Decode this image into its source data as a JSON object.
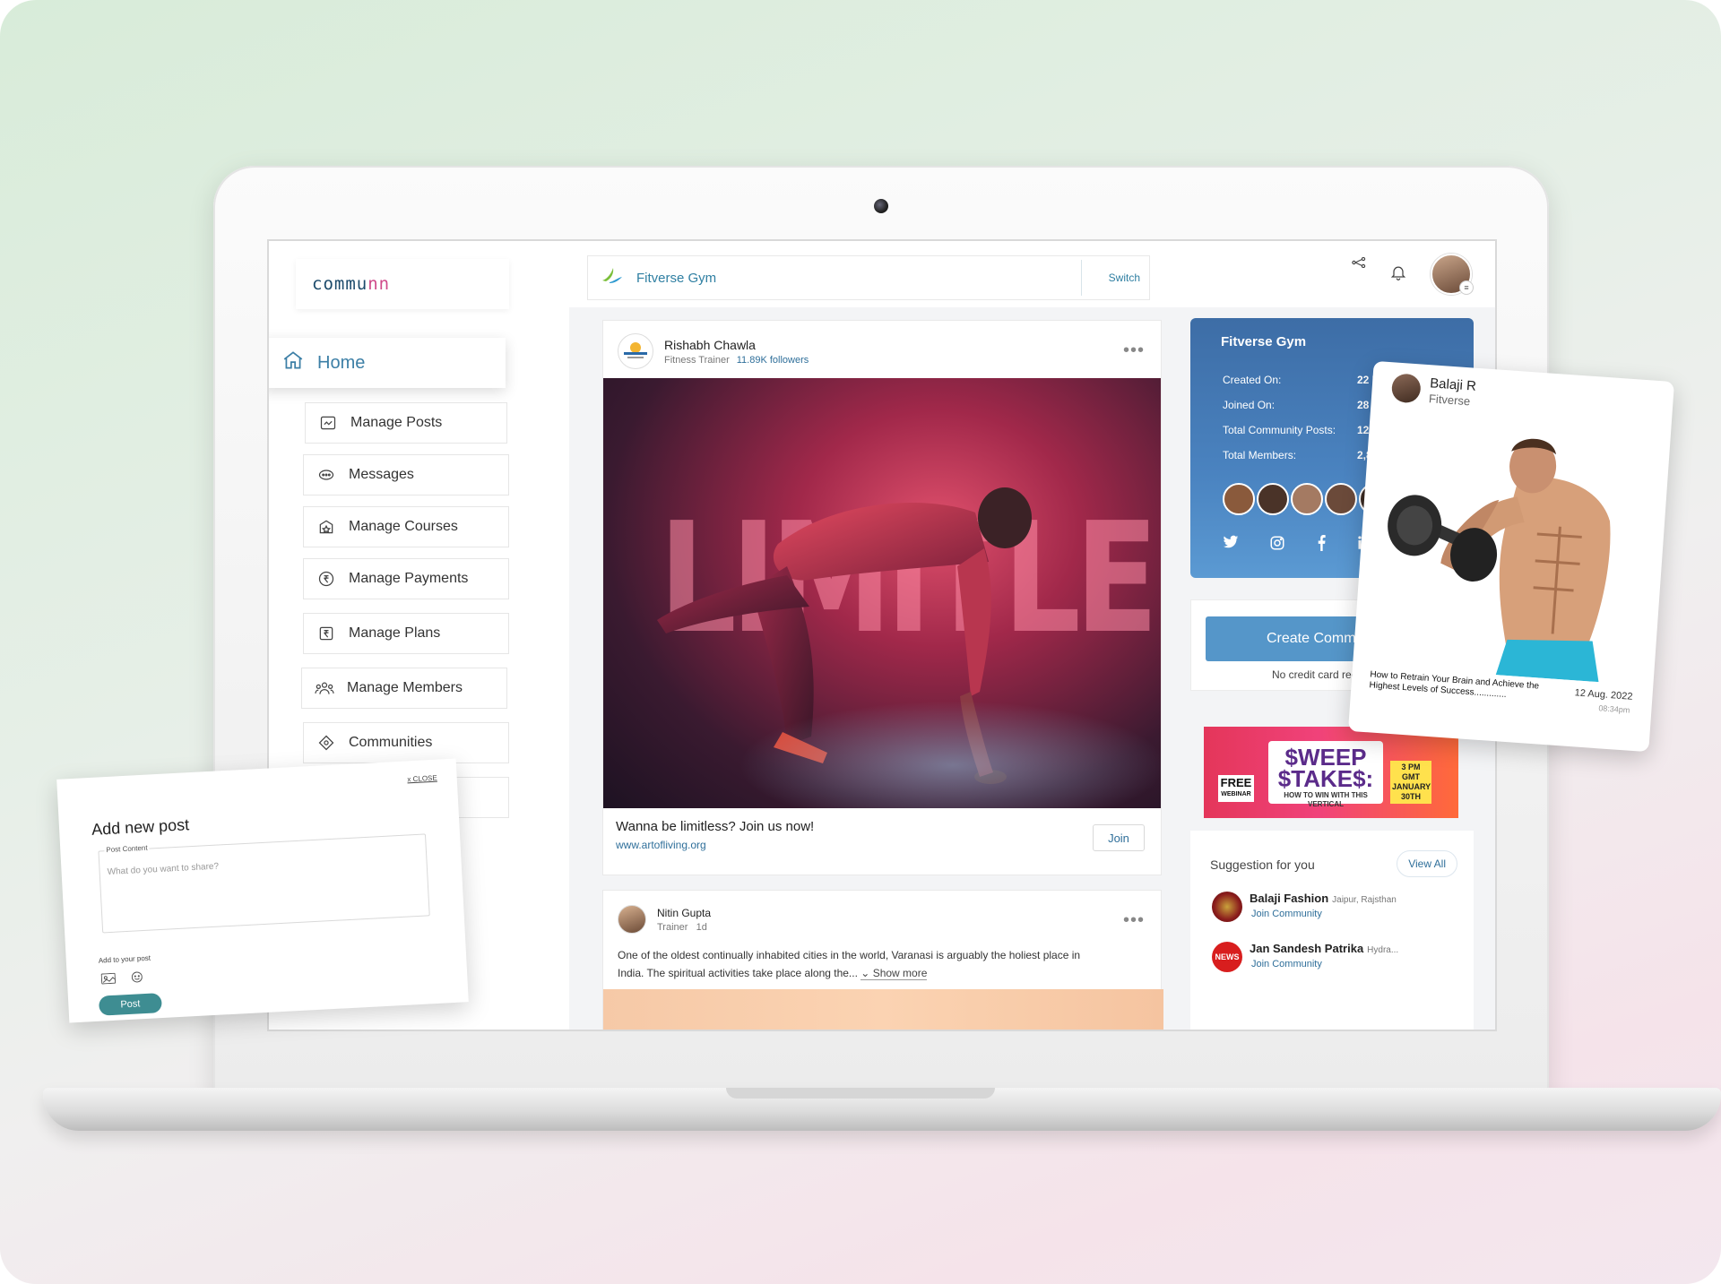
{
  "brand": {
    "logo_text_a": "commu",
    "logo_text_b": "nn"
  },
  "sidebar": {
    "home_label": "Home",
    "items": [
      {
        "label": "Manage Posts",
        "icon": "posts-icon"
      },
      {
        "label": "Messages",
        "icon": "messages-icon"
      },
      {
        "label": "Manage Courses",
        "icon": "courses-icon"
      },
      {
        "label": "Manage Payments",
        "icon": "payments-icon"
      },
      {
        "label": "Manage Plans",
        "icon": "plans-icon"
      },
      {
        "label": "Manage Members",
        "icon": "members-icon"
      },
      {
        "label": "Communities",
        "icon": "communities-icon"
      }
    ]
  },
  "topbar": {
    "community_name": "Fitverse Gym",
    "switch_label": "Switch"
  },
  "feed": {
    "post1": {
      "author": "Rishabh Chawla",
      "role": "Fitness Trainer",
      "followers": "11.89K followers",
      "image_word": "LIMITLESS",
      "caption": "Wanna be limitless? Join us now!",
      "link": "www.artofliving.org",
      "join_label": "Join"
    },
    "post2": {
      "author": "Nitin Gupta",
      "role": "Trainer",
      "age": "1d",
      "text_line1": "One of the oldest continually inhabited cities in the world, Varanasi is arguably the holiest place in",
      "text_line2": "India. The spiritual activities take place along the...",
      "show_more": "Show more"
    }
  },
  "community_card": {
    "title": "Fitverse Gym",
    "rows": [
      {
        "label": "Created On:",
        "value": "22 Feb. 20"
      },
      {
        "label": "Joined On:",
        "value": "28 Feb. 2"
      },
      {
        "label": "Total Community Posts:",
        "value": "1280"
      },
      {
        "label": "Total Members:",
        "value": "2,832"
      }
    ],
    "member_avatar_colors": [
      "#8a5a3c",
      "#4a3328",
      "#a47a62",
      "#6b4a3a",
      "#3a2a22"
    ],
    "socials": [
      "twitter-icon",
      "instagram-icon",
      "facebook-icon",
      "linkedin-icon"
    ]
  },
  "create_community": {
    "button_label": "Create Commu",
    "note": "No credit card requ"
  },
  "ad": {
    "free": "FREE",
    "free_sub": "WEBINAR",
    "headline": "$WEEP $TAKE$:",
    "sub": "HOW TO WIN WITH THIS VERTICAL",
    "date": "3 PM GMT JANUARY 30TH"
  },
  "suggestions": {
    "title": "Suggestion for you",
    "view_all": "View All",
    "items": [
      {
        "name": "Balaji Fashion",
        "location": "Jaipur, Rajsthan",
        "action": "Join Community",
        "color": "#8a1c1c"
      },
      {
        "name": "Jan Sandesh Patrika",
        "location": "Hydra...",
        "action": "Join Community",
        "color": "#d81e1e"
      }
    ]
  },
  "floating_post": {
    "author": "Balaji R",
    "community": "Fitverse",
    "caption": "How to Retrain Your Brain and Achieve the Highest Levels of Success.............",
    "date": "12 Aug. 2022",
    "time": "08:34pm"
  },
  "add_post": {
    "title": "Add new post",
    "close_label": "x CLOSE",
    "field_label": "Post Content",
    "placeholder": "What do you want to share?",
    "add_label": "Add to your post",
    "post_button": "Post"
  }
}
